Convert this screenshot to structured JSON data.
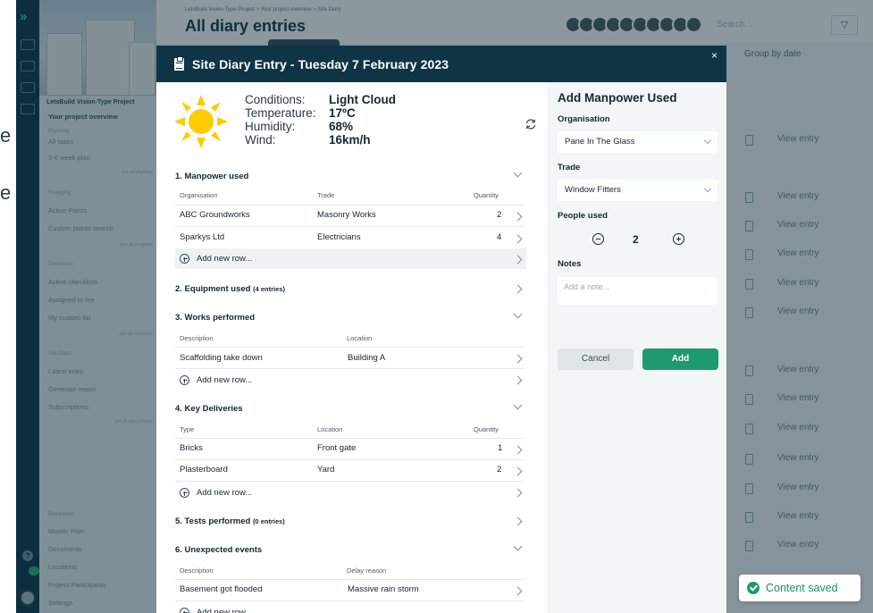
{
  "background": {
    "edge_text_1": "e",
    "edge_text_2": "e",
    "breadcrumb": "LetsBuild Vision-Type Project  >  Your project overview  >  Site Diary",
    "page_title": "All diary entries",
    "search_placeholder": "Search...",
    "group_by_label": "Group by date",
    "view_entry_label": "View entry",
    "sidebar": {
      "project_name": "LetsBuild Vision-Type Project",
      "overview": "Your project overview",
      "sections": [
        {
          "title": "Planning",
          "items": [
            "All tasks",
            "3-6 week plan"
          ],
          "more": "see all planning"
        },
        {
          "title": "Snagging",
          "items": [
            "Active Points",
            "Custom points search"
          ],
          "more": "See all snagging"
        },
        {
          "title": "Checklists",
          "items": [
            "Active checklists",
            "Assigned to me",
            "My custom list"
          ],
          "more": "see all checklists"
        },
        {
          "title": "Site Diary",
          "items": [
            "Latest entry",
            "Generate report",
            "Subscriptions"
          ],
          "more": "see all diary entries"
        },
        {
          "title": "Resources",
          "items": [
            "Master Plan",
            "Documents",
            "Locations",
            "Project Participants",
            "Settings"
          ],
          "more": ""
        }
      ]
    }
  },
  "modal": {
    "title": "Site Diary Entry - Tuesday 7 February 2023",
    "close_label": "×",
    "weather": {
      "icon": "sun-icon",
      "conditions_label": "Conditions:",
      "conditions_value": "Light Cloud",
      "temperature_label": "Temperature:",
      "temperature_value": "17ºC",
      "humidity_label": "Humidity:",
      "humidity_value": "68%",
      "wind_label": "Wind:",
      "wind_value": "16km/h"
    },
    "add_new_row": "Add new row...",
    "sections": {
      "manpower": {
        "title": "1. Manpower used",
        "columns": [
          "Organisation",
          "Trade",
          "Quantity"
        ],
        "rows": [
          {
            "organisation": "ABC Groundworks",
            "trade": "Masonry Works",
            "quantity": "2"
          },
          {
            "organisation": "Sparkys Ltd",
            "trade": "Electricians",
            "quantity": "4"
          }
        ]
      },
      "equipment": {
        "title": "2. Equipment used",
        "count": "(4 entries)"
      },
      "works": {
        "title": "3. Works performed",
        "columns": [
          "Description",
          "Location"
        ],
        "rows": [
          {
            "description": "Scaffolding take down",
            "location": "Building A"
          }
        ]
      },
      "deliveries": {
        "title": "4. Key Deliveries",
        "columns": [
          "Type",
          "Location",
          "Quantity"
        ],
        "rows": [
          {
            "type": "Bricks",
            "location": "Front gate",
            "quantity": "1"
          },
          {
            "type": "Plasterboard",
            "location": "Yard",
            "quantity": "2"
          }
        ]
      },
      "tests": {
        "title": "5. Tests performed",
        "count": "(0 entries)"
      },
      "unexpected": {
        "title": "6. Unexpected events",
        "columns": [
          "Description",
          "Delay reason"
        ],
        "rows": [
          {
            "description": "Basement got flooded",
            "reason": "Massive rain storm"
          }
        ]
      }
    },
    "panel": {
      "title": "Add Manpower Used",
      "organisation_label": "Organisation",
      "organisation_value": "Pane In The Glass",
      "trade_label": "Trade",
      "trade_value": "Window Fitters",
      "people_label": "People used",
      "people_value": "2",
      "notes_label": "Notes",
      "notes_placeholder": "Add a note...",
      "cancel_label": "Cancel",
      "add_label": "Add"
    }
  },
  "toast": {
    "message": "Content saved"
  },
  "colors": {
    "header_bg": "#0f3446",
    "primary_green": "#1e9b6e",
    "sun": "#ffcc00",
    "rail": "#0d3547"
  }
}
